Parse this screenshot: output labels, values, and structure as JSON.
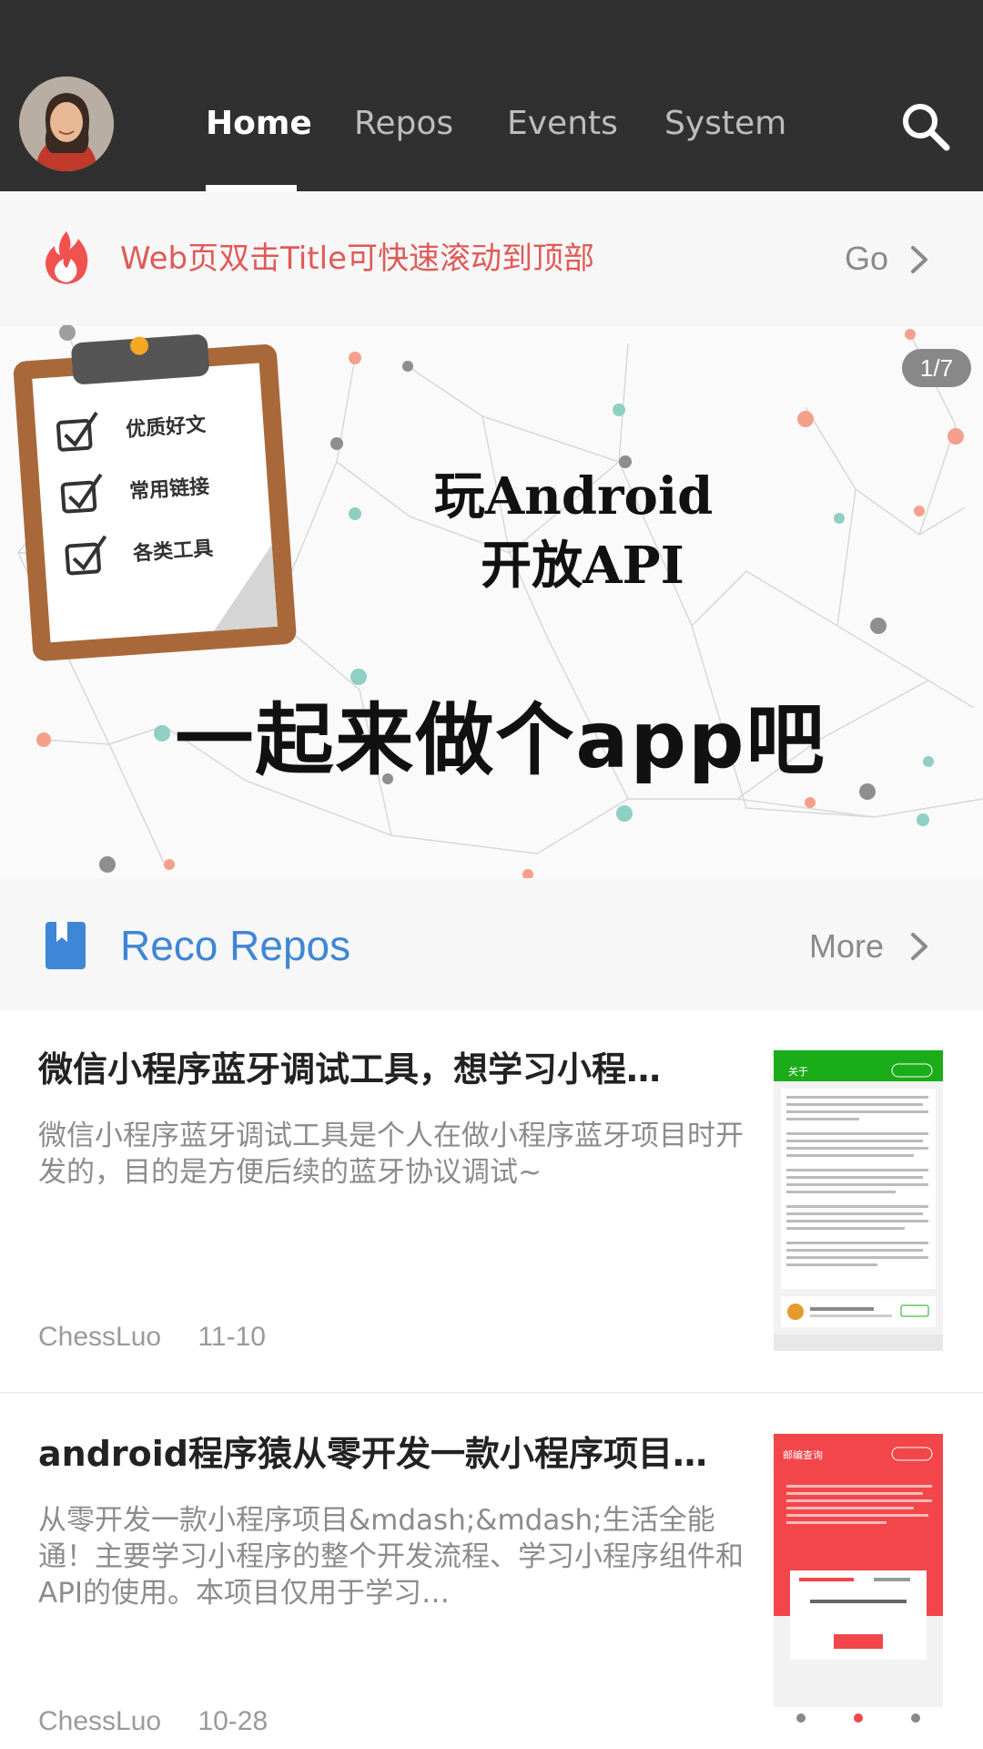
{
  "nav": {
    "tabs": [
      {
        "label": "Home",
        "active": true
      },
      {
        "label": "Repos",
        "active": false
      },
      {
        "label": "Events",
        "active": false
      },
      {
        "label": "System",
        "active": false
      }
    ],
    "icons": {
      "avatar": "user-avatar",
      "search": "search-icon"
    }
  },
  "tip": {
    "icon": "flame-icon",
    "text": "Web页双击Title可快速滚动到顶部",
    "action_label": "Go"
  },
  "banner": {
    "pager": "1/7",
    "title_line1": "玩Android",
    "title_line2": "开放API",
    "slogan": "一起来做个app吧",
    "checklist": [
      "优质好文",
      "常用链接",
      "各类工具"
    ]
  },
  "section": {
    "icon": "bookmark-icon",
    "title": "Reco Repos",
    "more_label": "More"
  },
  "repos": [
    {
      "title": "微信小程序蓝牙调试工具，想学习小程…",
      "desc": "微信小程序蓝牙调试工具是个人在做小程序蓝牙项目时开发的，目的是方便后续的蓝牙协议调试~",
      "author": "ChessLuo",
      "date": "11-10",
      "thumb": {
        "header": "关于",
        "accent": "#1aad19"
      }
    },
    {
      "title": "android程序猿从零开发一款小程序项目…",
      "desc": "从零开发一款小程序项目&mdash;&mdash;生活全能通！主要学习小程序的整个开发流程、学习小程序组件和API的使用。本项目仅用于学习…",
      "author": "ChessLuo",
      "date": "10-28",
      "thumb": {
        "header": "邮编查询",
        "accent": "#f2464b"
      }
    }
  ],
  "colors": {
    "appbar": "#303030",
    "tip_text": "#e05a57",
    "section_title": "#3e86d6"
  }
}
